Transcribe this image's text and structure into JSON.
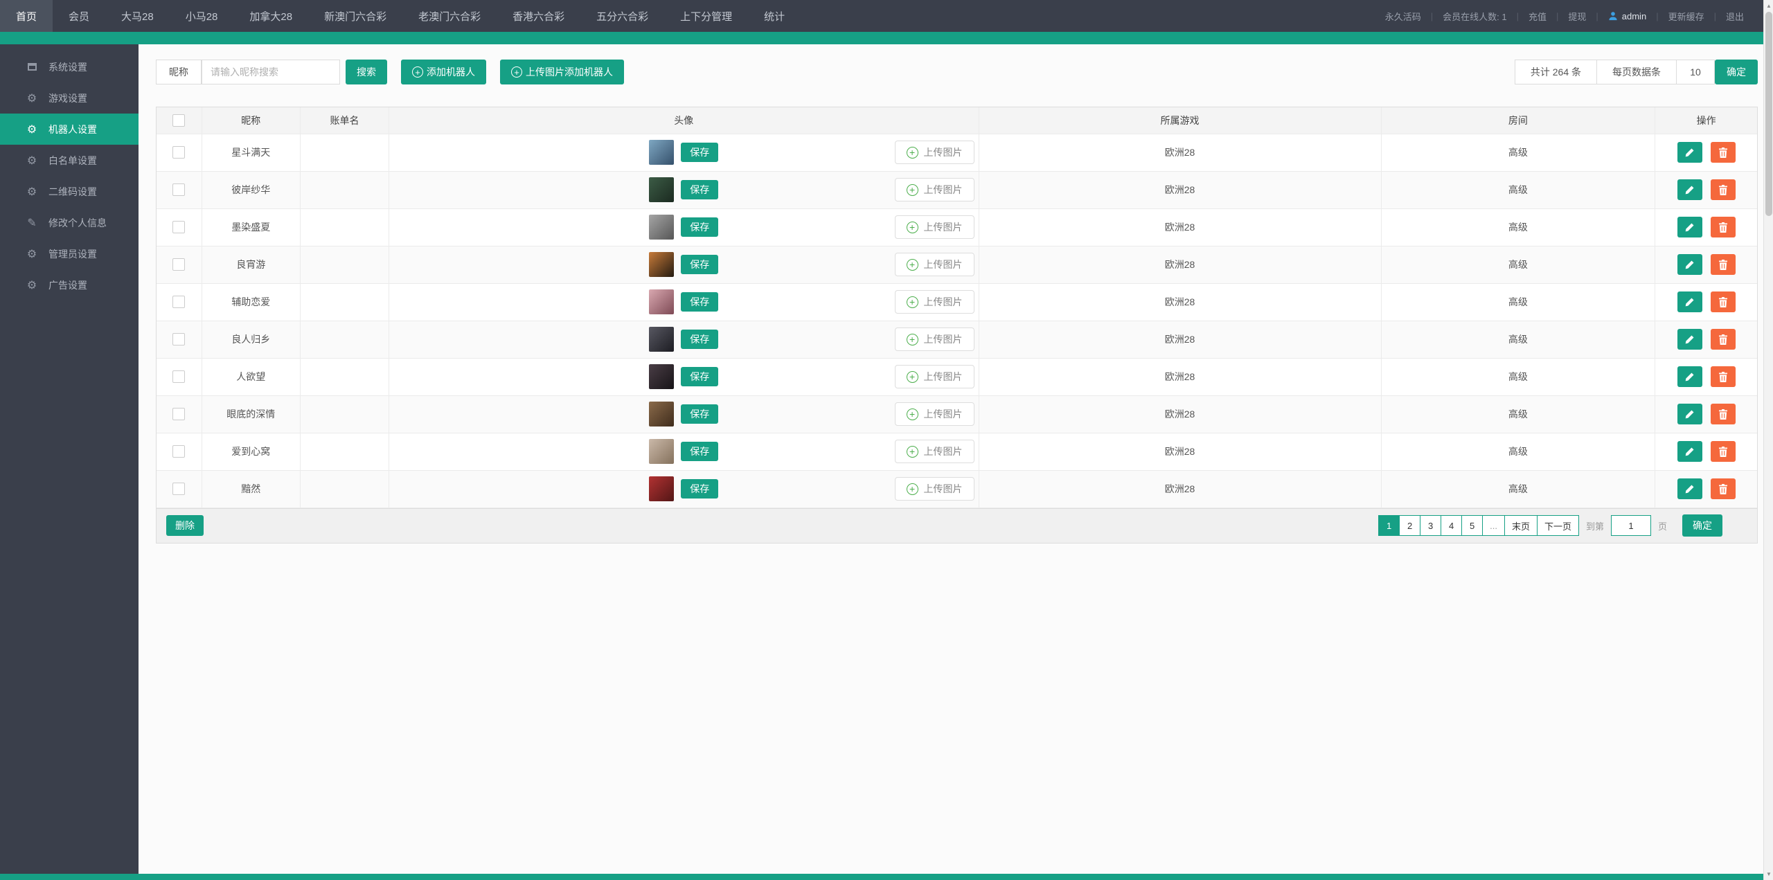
{
  "colors": {
    "teal": "#16a085",
    "orange": "#f5683c",
    "dark": "#3a3f4b",
    "admin_blue": "#3d9fe0",
    "plus_green": "#4cae4c"
  },
  "topnav": {
    "items": [
      {
        "label": "首页",
        "active": true
      },
      {
        "label": "会员"
      },
      {
        "label": "大马28"
      },
      {
        "label": "小马28"
      },
      {
        "label": "加拿大28"
      },
      {
        "label": "新澳门六合彩"
      },
      {
        "label": "老澳门六合彩"
      },
      {
        "label": "香港六合彩"
      },
      {
        "label": "五分六合彩"
      },
      {
        "label": "上下分管理"
      },
      {
        "label": "统计"
      }
    ],
    "right": [
      {
        "label": "永久活码",
        "type": "link"
      },
      {
        "label": "会员在线人数: 1",
        "type": "status"
      },
      {
        "label": "充值",
        "type": "link"
      },
      {
        "label": "提现",
        "type": "link"
      },
      {
        "label": "admin",
        "type": "user",
        "icon": "user-icon"
      },
      {
        "label": "更新缓存",
        "type": "link"
      },
      {
        "label": "退出",
        "type": "link"
      }
    ]
  },
  "sidebar": {
    "items": [
      {
        "icon": "window-icon",
        "label": "系统设置"
      },
      {
        "icon": "gear-icon",
        "label": "游戏设置"
      },
      {
        "icon": "gear-icon",
        "label": "机器人设置",
        "active": true
      },
      {
        "icon": "gear-icon",
        "label": "白名单设置"
      },
      {
        "icon": "gear-icon",
        "label": "二维码设置"
      },
      {
        "icon": "pencil-icon",
        "label": "修改个人信息"
      },
      {
        "icon": "gear-icon",
        "label": "管理员设置"
      },
      {
        "icon": "gear-icon",
        "label": "广告设置"
      }
    ]
  },
  "toolbar": {
    "filter_label": "昵称",
    "search_placeholder": "请输入昵称搜索",
    "search_button": "搜索",
    "add_robot_button": "添加机器人",
    "upload_add_robot_button": "上传图片添加机器人",
    "total_text": "共计 264 条",
    "per_page_label": "每页数据条",
    "per_page_value": "10",
    "confirm_button": "确定"
  },
  "table": {
    "headers": [
      "昵称",
      "账单名",
      "头像",
      "所属游戏",
      "房间",
      "操作"
    ],
    "save_button": "保存",
    "upload_button": "上传图片",
    "rows": [
      {
        "nickname": "星斗满天",
        "account": "",
        "game": "欧洲28",
        "room": "高级",
        "avatar_colors": [
          "#7ea7c2",
          "#35506b"
        ]
      },
      {
        "nickname": "彼岸纱华",
        "account": "",
        "game": "欧洲28",
        "room": "高级",
        "avatar_colors": [
          "#3c5c46",
          "#1b2a20"
        ]
      },
      {
        "nickname": "墨染盛夏",
        "account": "",
        "game": "欧洲28",
        "room": "高级",
        "avatar_colors": [
          "#a5a5a5",
          "#565656"
        ]
      },
      {
        "nickname": "良宵游",
        "account": "",
        "game": "欧洲28",
        "room": "高级",
        "avatar_colors": [
          "#c77b3a",
          "#241a10"
        ]
      },
      {
        "nickname": "辅助恋爱",
        "account": "",
        "game": "欧洲28",
        "room": "高级",
        "avatar_colors": [
          "#d9a8b0",
          "#7e4a55"
        ]
      },
      {
        "nickname": "良人归乡",
        "account": "",
        "game": "欧洲28",
        "room": "高级",
        "avatar_colors": [
          "#585862",
          "#1c1c22"
        ]
      },
      {
        "nickname": "人欲望",
        "account": "",
        "game": "欧洲28",
        "room": "高级",
        "avatar_colors": [
          "#4a3e46",
          "#171317"
        ]
      },
      {
        "nickname": "眼底的深情",
        "account": "",
        "game": "欧洲28",
        "room": "高级",
        "avatar_colors": [
          "#8a6a4a",
          "#3f2c1c"
        ]
      },
      {
        "nickname": "爱到心窝",
        "account": "",
        "game": "欧洲28",
        "room": "高级",
        "avatar_colors": [
          "#cbb9a9",
          "#84715c"
        ]
      },
      {
        "nickname": "黯然",
        "account": "",
        "game": "欧洲28",
        "room": "高级",
        "avatar_colors": [
          "#b23232",
          "#521616"
        ]
      }
    ]
  },
  "footer": {
    "delete_button": "删除",
    "pages": [
      {
        "label": "1",
        "active": true
      },
      {
        "label": "2"
      },
      {
        "label": "3"
      },
      {
        "label": "4"
      },
      {
        "label": "5"
      },
      {
        "label": "...",
        "dots": true
      },
      {
        "label": "末页"
      },
      {
        "label": "下一页"
      }
    ],
    "goto_prefix": "到第",
    "goto_value": "1",
    "goto_suffix": "页",
    "confirm_button": "确定"
  }
}
